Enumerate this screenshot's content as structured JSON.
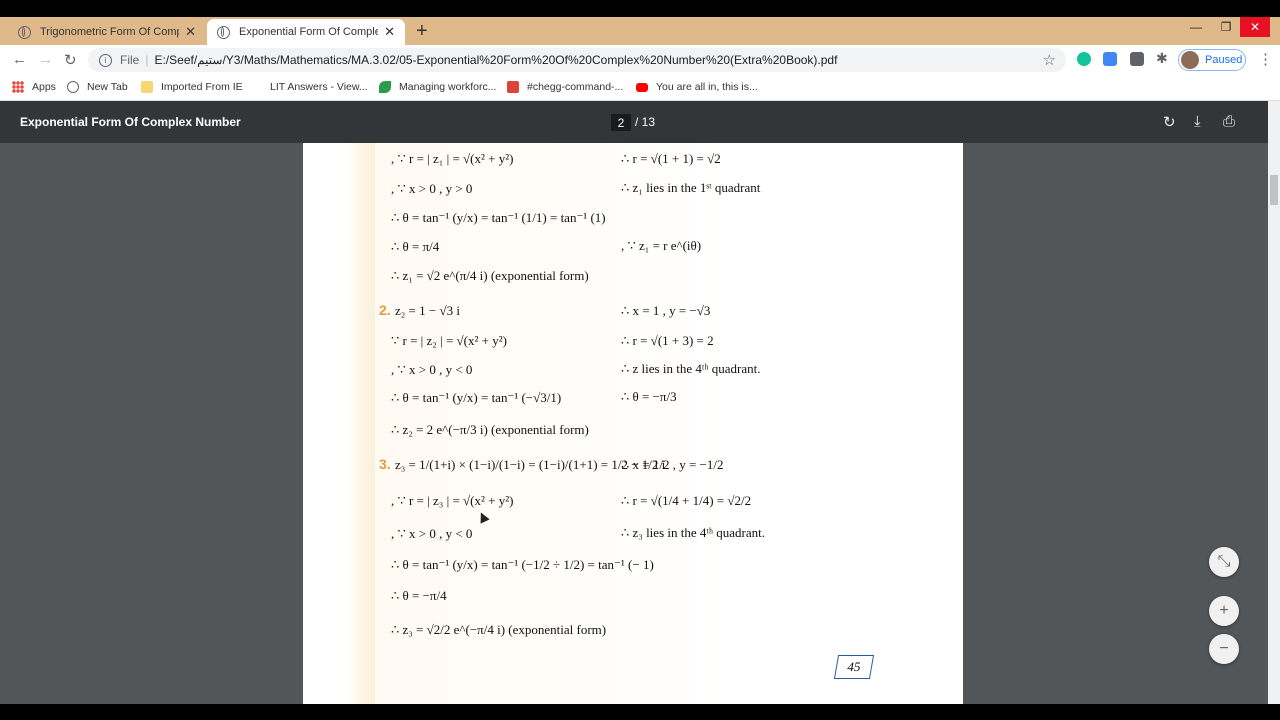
{
  "tabs": [
    {
      "title": "Trigonometric Form Of Complex Number",
      "close": "✕"
    },
    {
      "title": "Exponential Form Of Complex Number",
      "close": "✕"
    }
  ],
  "newtab_icon": "+",
  "window_controls": {
    "minimize": "—",
    "maximize": "❐",
    "close": "✕"
  },
  "nav": {
    "back": "←",
    "forward": "→",
    "reload": "↻"
  },
  "address": {
    "scheme_label": "File",
    "url": "E:/Seef/ستيم/Y3/Maths/Mathematics/MA.3.02/05-Exponential%20Form%20Of%20Complex%20Number%20(Extra%20Book).pdf"
  },
  "profile": {
    "status": "Paused"
  },
  "bookmarks": [
    {
      "label": "Apps",
      "icon": "apps-grid-icon"
    },
    {
      "label": "New Tab",
      "icon": "globe-icon"
    },
    {
      "label": "Imported From IE",
      "icon": "folder-icon"
    },
    {
      "label": "LIT Answers - View...",
      "icon": "blank-icon"
    },
    {
      "label": "Managing workforc...",
      "icon": "leaf-icon"
    },
    {
      "label": "#chegg-command-...",
      "icon": "calendar-icon"
    },
    {
      "label": "You are all in, this is...",
      "icon": "youtube-icon"
    }
  ],
  "pdf": {
    "title": "Exponential Form Of Complex Number",
    "current_page": "2",
    "total_pages": "/ 13",
    "page_number_box": "45"
  },
  "content": {
    "l1a": ", ∵ r = | z₁ | = √(x² + y²)",
    "l1b": "∴ r = √(1 + 1) = √2",
    "l2a": ", ∵ x > 0   ,  y > 0",
    "l2b": "∴ z₁ lies in the 1ˢᵗ quadrant",
    "l3a": "∴ θ = tan⁻¹ (y/x) = tan⁻¹ (1/1) = tan⁻¹ (1)",
    "l4a": "∴ θ = π/4",
    "l4b": ", ∵ z₁ = r e^(iθ)",
    "l5a": "∴ z₁ = √2 e^(π/4 i)  (exponential form)",
    "n2": "2.",
    "l6a": "z₂ = 1 − √3 i",
    "l6b": "∴ x = 1      ,     y = −√3",
    "l7a": "∵ r = | z₂ | = √(x² + y²)",
    "l7b": "∴ r = √(1 + 3) = 2",
    "l8a": ", ∵ x > 0   ,  y < 0",
    "l8b": "∴ z lies in the 4ᵗʰ quadrant.",
    "l9a": "∴ θ = tan⁻¹ (y/x) = tan⁻¹ (−√3/1)",
    "l9b": "∴ θ = −π/3",
    "l10a": "∴ z₂ = 2 e^(−π/3 i)  (exponential form)",
    "n3": "3.",
    "l11a": "z₃ = 1/(1+i) × (1−i)/(1−i) = (1−i)/(1+1) = 1/2 − 1/2 i",
    "l11b": "∴ x = 1/2  , y = −1/2",
    "l12a": ", ∵ r = | z₃ | = √(x² + y²)",
    "l12b": "∴ r = √(1/4 + 1/4) = √2/2",
    "l13a": ", ∵ x > 0  , y < 0",
    "l13b": "∴ z₃ lies in the 4ᵗʰ quadrant.",
    "l14a": "∴ θ = tan⁻¹ (y/x) = tan⁻¹ (−1/2 ÷ 1/2) = tan⁻¹ (− 1)",
    "l15a": "∴ θ = −π/4",
    "l16a": "∴ z₃ = √2/2 e^(−π/4 i)  (exponential form)"
  },
  "fab": {
    "fit": "⤡",
    "zoom_in": "+",
    "zoom_out": "−"
  }
}
